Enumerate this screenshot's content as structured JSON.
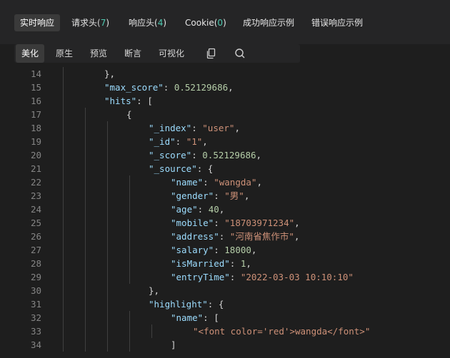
{
  "tabs": [
    {
      "label": "实时响应",
      "count": ""
    },
    {
      "label": "请求头",
      "count": "7"
    },
    {
      "label": "响应头",
      "count": "4"
    },
    {
      "label": "Cookie",
      "count": "0"
    },
    {
      "label": "成功响应示例",
      "count": ""
    },
    {
      "label": "错误响应示例",
      "count": ""
    }
  ],
  "view_modes": [
    "美化",
    "原生",
    "预览",
    "断言",
    "可视化"
  ],
  "toolbar_icons": [
    "copy-icon",
    "search-icon"
  ],
  "code_lines": [
    {
      "num": "14",
      "indent": 2,
      "tokens": [
        [
          "p",
          "},"
        ]
      ]
    },
    {
      "num": "15",
      "indent": 2,
      "tokens": [
        [
          "k",
          "\"max_score\""
        ],
        [
          "p",
          ": "
        ],
        [
          "n",
          "0.52129686"
        ],
        [
          "p",
          ","
        ]
      ]
    },
    {
      "num": "16",
      "indent": 2,
      "tokens": [
        [
          "k",
          "\"hits\""
        ],
        [
          "p",
          ": ["
        ]
      ]
    },
    {
      "num": "17",
      "indent": 3,
      "tokens": [
        [
          "p",
          "{"
        ]
      ]
    },
    {
      "num": "18",
      "indent": 4,
      "tokens": [
        [
          "k",
          "\"_index\""
        ],
        [
          "p",
          ": "
        ],
        [
          "s",
          "\"user\""
        ],
        [
          "p",
          ","
        ]
      ]
    },
    {
      "num": "19",
      "indent": 4,
      "tokens": [
        [
          "k",
          "\"_id\""
        ],
        [
          "p",
          ": "
        ],
        [
          "s",
          "\"1\""
        ],
        [
          "p",
          ","
        ]
      ]
    },
    {
      "num": "20",
      "indent": 4,
      "tokens": [
        [
          "k",
          "\"_score\""
        ],
        [
          "p",
          ": "
        ],
        [
          "n",
          "0.52129686"
        ],
        [
          "p",
          ","
        ]
      ]
    },
    {
      "num": "21",
      "indent": 4,
      "tokens": [
        [
          "k",
          "\"_source\""
        ],
        [
          "p",
          ": {"
        ]
      ]
    },
    {
      "num": "22",
      "indent": 5,
      "tokens": [
        [
          "k",
          "\"name\""
        ],
        [
          "p",
          ": "
        ],
        [
          "s",
          "\"wangda\""
        ],
        [
          "p",
          ","
        ]
      ]
    },
    {
      "num": "23",
      "indent": 5,
      "tokens": [
        [
          "k",
          "\"gender\""
        ],
        [
          "p",
          ": "
        ],
        [
          "s",
          "\"男\""
        ],
        [
          "p",
          ","
        ]
      ]
    },
    {
      "num": "24",
      "indent": 5,
      "tokens": [
        [
          "k",
          "\"age\""
        ],
        [
          "p",
          ": "
        ],
        [
          "n",
          "40"
        ],
        [
          "p",
          ","
        ]
      ]
    },
    {
      "num": "25",
      "indent": 5,
      "tokens": [
        [
          "k",
          "\"mobile\""
        ],
        [
          "p",
          ": "
        ],
        [
          "s",
          "\"18703971234\""
        ],
        [
          "p",
          ","
        ]
      ]
    },
    {
      "num": "26",
      "indent": 5,
      "tokens": [
        [
          "k",
          "\"address\""
        ],
        [
          "p",
          ": "
        ],
        [
          "s",
          "\"河南省焦作市\""
        ],
        [
          "p",
          ","
        ]
      ]
    },
    {
      "num": "27",
      "indent": 5,
      "tokens": [
        [
          "k",
          "\"salary\""
        ],
        [
          "p",
          ": "
        ],
        [
          "n",
          "18000"
        ],
        [
          "p",
          ","
        ]
      ]
    },
    {
      "num": "28",
      "indent": 5,
      "tokens": [
        [
          "k",
          "\"isMarried\""
        ],
        [
          "p",
          ": "
        ],
        [
          "n",
          "1"
        ],
        [
          "p",
          ","
        ]
      ]
    },
    {
      "num": "29",
      "indent": 5,
      "tokens": [
        [
          "k",
          "\"entryTime\""
        ],
        [
          "p",
          ": "
        ],
        [
          "s",
          "\"2022-03-03 10:10:10\""
        ]
      ]
    },
    {
      "num": "30",
      "indent": 4,
      "tokens": [
        [
          "p",
          "},"
        ]
      ]
    },
    {
      "num": "31",
      "indent": 4,
      "tokens": [
        [
          "k",
          "\"highlight\""
        ],
        [
          "p",
          ": {"
        ]
      ]
    },
    {
      "num": "32",
      "indent": 5,
      "tokens": [
        [
          "k",
          "\"name\""
        ],
        [
          "p",
          ": ["
        ]
      ]
    },
    {
      "num": "33",
      "indent": 6,
      "tokens": [
        [
          "s",
          "\"<font color='red'>wangda</font>\""
        ]
      ]
    },
    {
      "num": "34",
      "indent": 5,
      "tokens": [
        [
          "p",
          "]"
        ]
      ]
    }
  ],
  "colors": {
    "background": "#1e1e1e",
    "key": "#9cdcfe",
    "string": "#ce9178",
    "number": "#b5cea8",
    "line_number": "#858585",
    "count": "#4ec9b0"
  }
}
